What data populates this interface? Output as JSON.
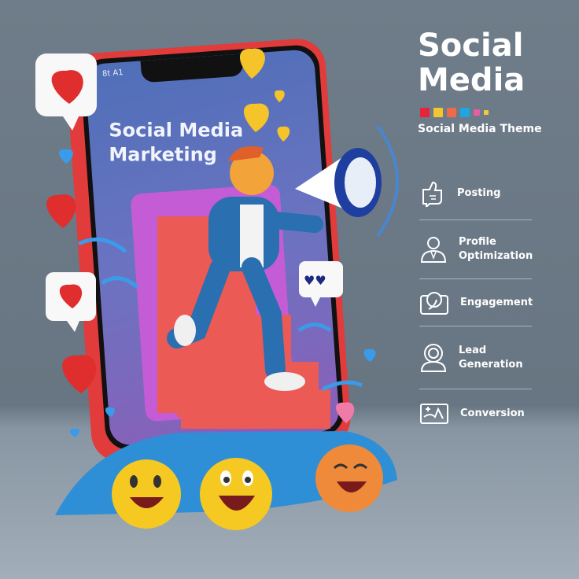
{
  "header": {
    "title_line1": "Social",
    "title_line2": "Media",
    "subtitle": "Social Media Theme"
  },
  "palette": [
    "#e8233a",
    "#f5c431",
    "#ee6a4a",
    "#1fa6e0",
    "#e85fa0",
    "#f0c93c"
  ],
  "phone": {
    "status_text": "8t A1",
    "screen_title_line1": "Social Media",
    "screen_title_line2": "Marketing"
  },
  "features": [
    {
      "label": "Posting",
      "icon": "thumb-icon"
    },
    {
      "label": "Profile Optimization",
      "icon": "user-icon"
    },
    {
      "label": "Engagement",
      "icon": "engagement-icon"
    },
    {
      "label": "Lead Generation",
      "icon": "target-user-icon"
    },
    {
      "label": "Conversion",
      "icon": "conversion-icon"
    }
  ]
}
